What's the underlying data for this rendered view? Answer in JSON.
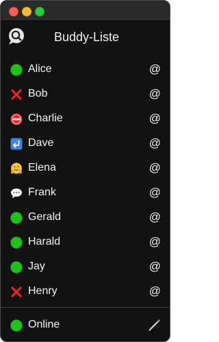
{
  "header": {
    "title": "Buddy-Liste",
    "logo_icon": "chat-magnifier-logo-icon"
  },
  "buddies": [
    {
      "name": "Alice",
      "status_icon": "online-dot-icon"
    },
    {
      "name": "Bob",
      "status_icon": "red-cross-icon"
    },
    {
      "name": "Charlie",
      "status_icon": "no-entry-icon"
    },
    {
      "name": "Dave",
      "status_icon": "return-arrow-icon"
    },
    {
      "name": "Elena",
      "status_icon": "hugging-face-icon"
    },
    {
      "name": "Frank",
      "status_icon": "speech-bubble-icon"
    },
    {
      "name": "Gerald",
      "status_icon": "online-dot-icon"
    },
    {
      "name": "Harald",
      "status_icon": "online-dot-icon"
    },
    {
      "name": "Jay",
      "status_icon": "online-dot-icon"
    },
    {
      "name": "Henry",
      "status_icon": "red-cross-icon"
    }
  ],
  "row_action_symbol": "@",
  "footer": {
    "status_label": "Online",
    "status_icon": "online-dot-icon",
    "edit_icon": "pen-icon"
  },
  "colors": {
    "online": "#1fc21a",
    "offline": "#e8232a",
    "background": "#121212",
    "text": "#f2f2f2"
  }
}
